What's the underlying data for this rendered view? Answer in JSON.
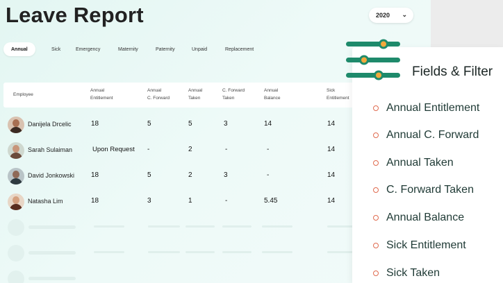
{
  "page": {
    "title": "Leave Report",
    "year_selector": {
      "value": "2020"
    }
  },
  "tabs": [
    {
      "label": "Annual",
      "active": true
    },
    {
      "label": "Sick",
      "active": false
    },
    {
      "label": "Emergency",
      "active": false
    },
    {
      "label": "Maternity",
      "active": false
    },
    {
      "label": "Paternity",
      "active": false
    },
    {
      "label": "Unpaid",
      "active": false
    },
    {
      "label": "Replacement",
      "active": false
    }
  ],
  "table": {
    "columns": [
      {
        "line1": "Employee",
        "line2": ""
      },
      {
        "line1": "Annual",
        "line2": "Entitlement"
      },
      {
        "line1": "Annual",
        "line2": "C. Forward"
      },
      {
        "line1": "Annual",
        "line2": "Taken"
      },
      {
        "line1": "C. Forward",
        "line2": "Taken"
      },
      {
        "line1": "Annual",
        "line2": "Balance"
      },
      {
        "line1": "Sick",
        "line2": "Entitlement"
      }
    ],
    "rows": [
      {
        "name": "Danijela Drcelic",
        "annual_entitlement": "18",
        "annual_cforward": "5",
        "annual_taken": "5",
        "cforward_taken": "3",
        "annual_balance": "14",
        "sick_entitlement": "14"
      },
      {
        "name": "Sarah Sulaiman",
        "annual_entitlement": "Upon Request",
        "annual_cforward": "-",
        "annual_taken": "2",
        "cforward_taken": "-",
        "annual_balance": "-",
        "sick_entitlement": "14"
      },
      {
        "name": "David Jonkowski",
        "annual_entitlement": "18",
        "annual_cforward": "5",
        "annual_taken": "2",
        "cforward_taken": "3",
        "annual_balance": "-",
        "sick_entitlement": "14"
      },
      {
        "name": "Natasha Lim",
        "annual_entitlement": "18",
        "annual_cforward": "3",
        "annual_taken": "1",
        "cforward_taken": "-",
        "annual_balance": "5.45",
        "sick_entitlement": "14"
      }
    ]
  },
  "panel": {
    "title": "Fields & Filter",
    "fields": [
      "Annual Entitlement",
      "Annual C. Forward",
      "Annual Taken",
      "C. Forward Taken",
      "Annual Balance",
      "Sick Entitlement",
      "Sick Taken"
    ]
  },
  "colors": {
    "accent_green": "#1e8a6b",
    "accent_orange": "#f2a93b",
    "bullet": "#e06b4f"
  },
  "icons": {
    "year_dropdown": "chevron-down-icon",
    "panel_header": "sliders-icon",
    "field_bullet": "circle-bullet-icon"
  }
}
